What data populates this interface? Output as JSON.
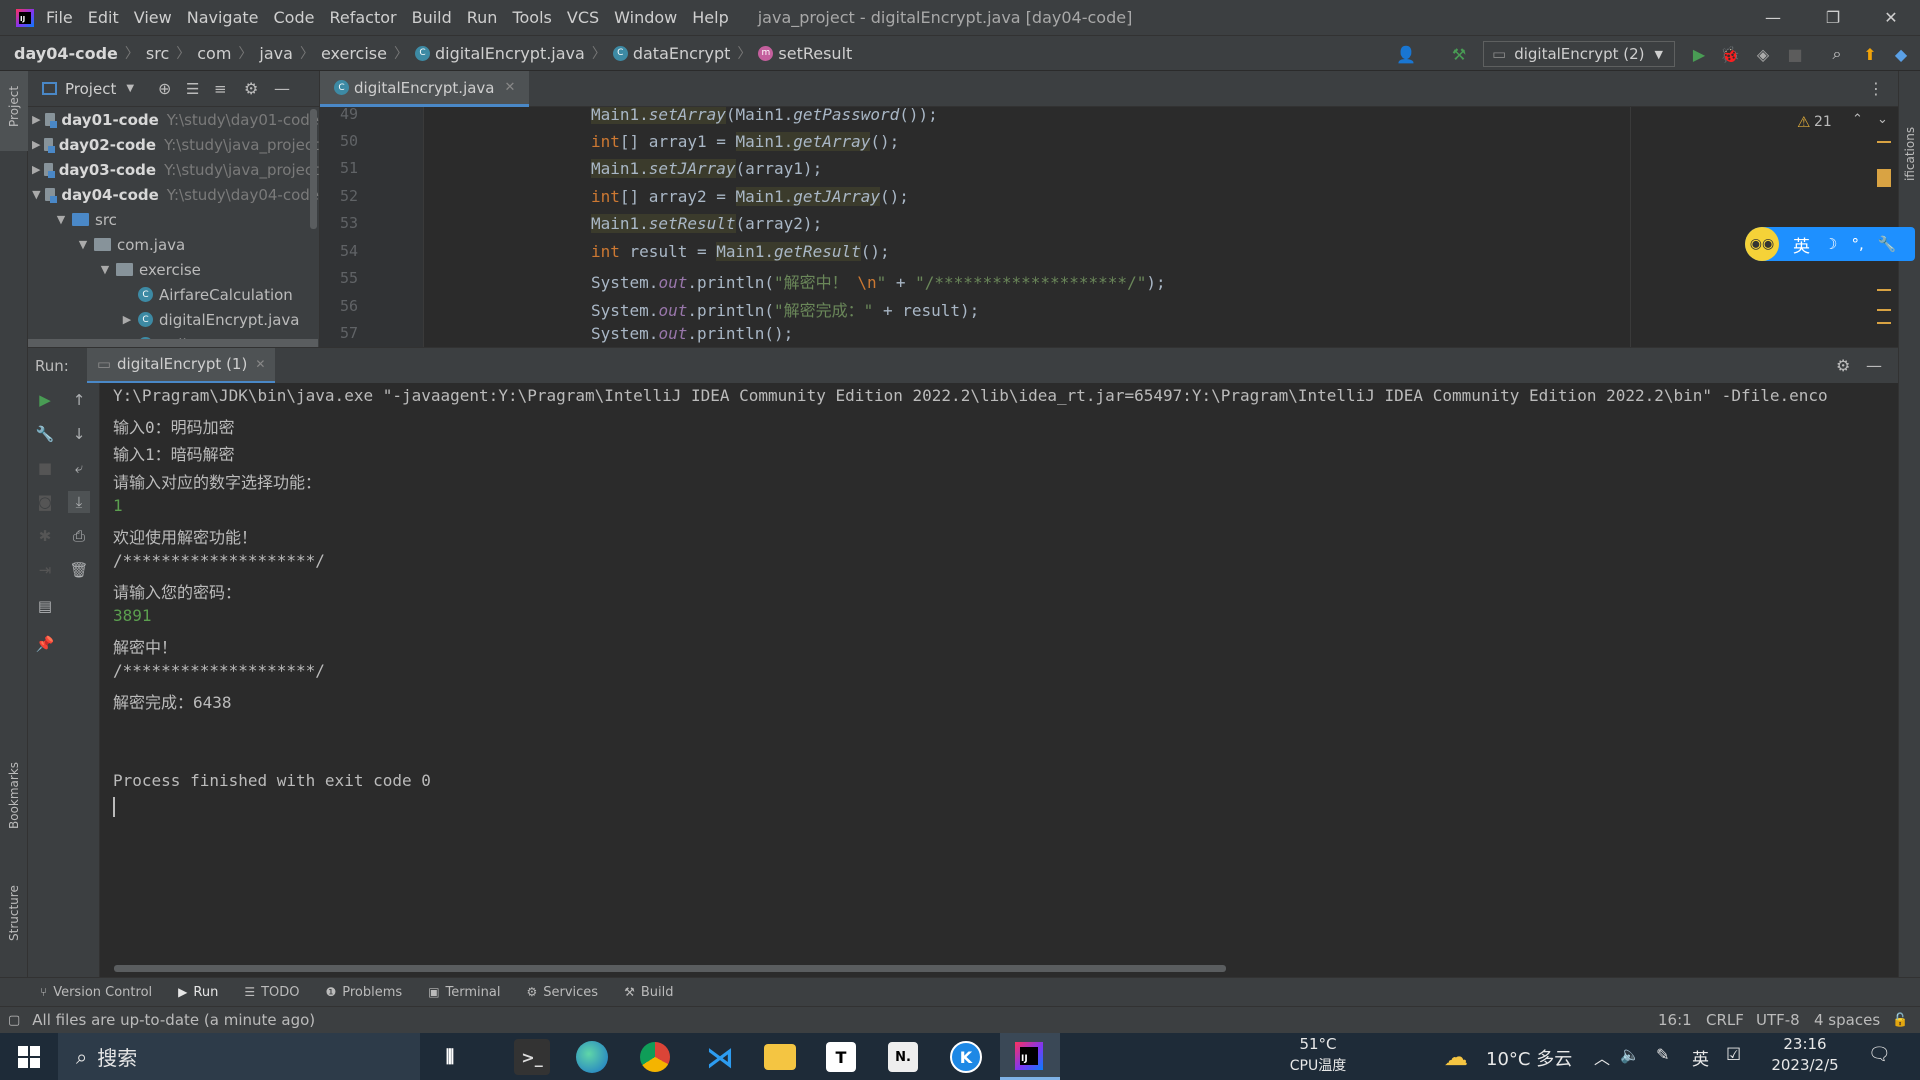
{
  "menu": {
    "items": [
      "File",
      "Edit",
      "View",
      "Navigate",
      "Code",
      "Refactor",
      "Build",
      "Run",
      "Tools",
      "VCS",
      "Window",
      "Help"
    ],
    "window_title": "java_project - digitalEncrypt.java [day04-code]"
  },
  "breadcrumb": {
    "project": "day04-code",
    "parts": [
      "src",
      "com",
      "java",
      "exercise"
    ],
    "file": "digitalEncrypt.java",
    "class": "dataEncrypt",
    "method": "setResult"
  },
  "run_config": {
    "label": "digitalEncrypt (2)"
  },
  "project_panel": {
    "title": "Project",
    "tree": [
      {
        "name": "day01-code",
        "hint": "Y:\\study\\day01-code"
      },
      {
        "name": "day02-code",
        "hint": "Y:\\study\\java_project"
      },
      {
        "name": "day03-code",
        "hint": "Y:\\study\\java_project"
      },
      {
        "name": "day04-code",
        "hint": "Y:\\study\\day04-code"
      },
      {
        "name": "src"
      },
      {
        "name": "com.java"
      },
      {
        "name": "exercise"
      },
      {
        "name": "AirfareCalculation"
      },
      {
        "name": "digitalEncrypt.java"
      },
      {
        "name": "Juding"
      }
    ]
  },
  "editor": {
    "tab": "digitalEncrypt.java",
    "warnings": "21",
    "line_numbers": [
      "49",
      "50",
      "51",
      "52",
      "53",
      "54",
      "55",
      "56",
      "57"
    ]
  },
  "run_panel": {
    "label": "Run:",
    "tab": "digitalEncrypt (1)"
  },
  "console": {
    "command": "Y:\\Pragram\\JDK\\bin\\java.exe \"-javaagent:Y:\\Pragram\\IntelliJ IDEA Community Edition 2022.2\\lib\\idea_rt.jar=65497:Y:\\Pragram\\IntelliJ IDEA Community Edition 2022.2\\bin\" -Dfile.enco",
    "lines": [
      "输入0：明码加密",
      "输入1：暗码解密",
      "请输入对应的数字选择功能：",
      "1",
      "欢迎使用解密功能！",
      "/********************/",
      "请输入您的密码：",
      "3891",
      "解密中！",
      "/********************/",
      "解密完成：6438",
      "",
      "",
      "Process finished with exit code 0"
    ]
  },
  "tool_tabs": [
    "Version Control",
    "Run",
    "TODO",
    "Problems",
    "Terminal",
    "Services",
    "Build"
  ],
  "left_strip": {
    "top": "Project",
    "bookmarks": "Bookmarks",
    "structure": "Structure"
  },
  "right_strip": {
    "notifications": "ifications"
  },
  "status": {
    "message": "All files are up-to-date (a minute ago)",
    "position": "16:1",
    "line_sep": "CRLF",
    "encoding": "UTF-8",
    "indent": "4 spaces"
  },
  "ime": {
    "lang": "英"
  },
  "taskbar": {
    "search": "搜索",
    "cpu_temp": "51°C",
    "cpu_label": "CPU温度",
    "weather": "10°C 多云",
    "ime": "英",
    "time": "23:16",
    "date": "2023/2/5"
  },
  "colors": {
    "accent": "#4a88c7",
    "run_green": "#499c54",
    "keyword": "#cc7832",
    "string": "#6a8759",
    "field": "#9876aa"
  }
}
